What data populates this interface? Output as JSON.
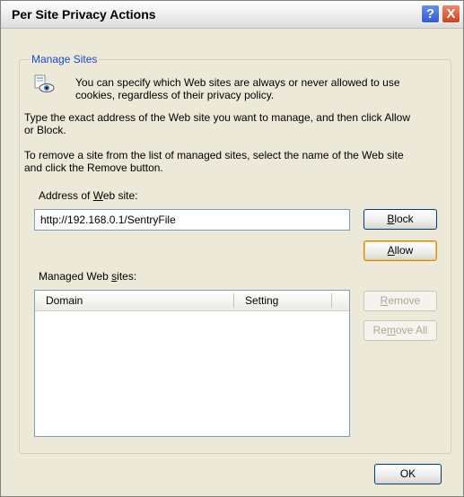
{
  "window": {
    "title": "Per Site Privacy Actions",
    "help_glyph": "?",
    "close_glyph": "X"
  },
  "group": {
    "label": "Manage Sites"
  },
  "info": {
    "icon": "privacy-eye-icon",
    "line1": "You can specify which Web sites are always or never allowed to use",
    "line2": "cookies, regardless of their privacy policy."
  },
  "instructions": {
    "p1_line1": "Type the exact address of the Web site you want to manage, and then click Allow",
    "p1_line2": "or Block.",
    "p2_line1": "To remove a site from the list of managed sites, select the name of the Web site",
    "p2_line2": "and click the Remove button."
  },
  "address": {
    "label_before": "Address of ",
    "label_underlined": "W",
    "label_after": "eb site:",
    "value": "http://192.168.0.1/SentryFile"
  },
  "buttons": {
    "block_u": "B",
    "block_rest": "lock",
    "allow_u": "A",
    "allow_rest": "llow",
    "remove_u": "R",
    "remove_rest": "emove",
    "remove_all_pre": "Re",
    "remove_all_u": "m",
    "remove_all_rest": "ove All",
    "ok": "OK"
  },
  "managed": {
    "label_before": "Managed Web ",
    "label_underlined": "s",
    "label_after": "ites:",
    "columns": [
      "Domain",
      "Setting"
    ],
    "rows": []
  }
}
